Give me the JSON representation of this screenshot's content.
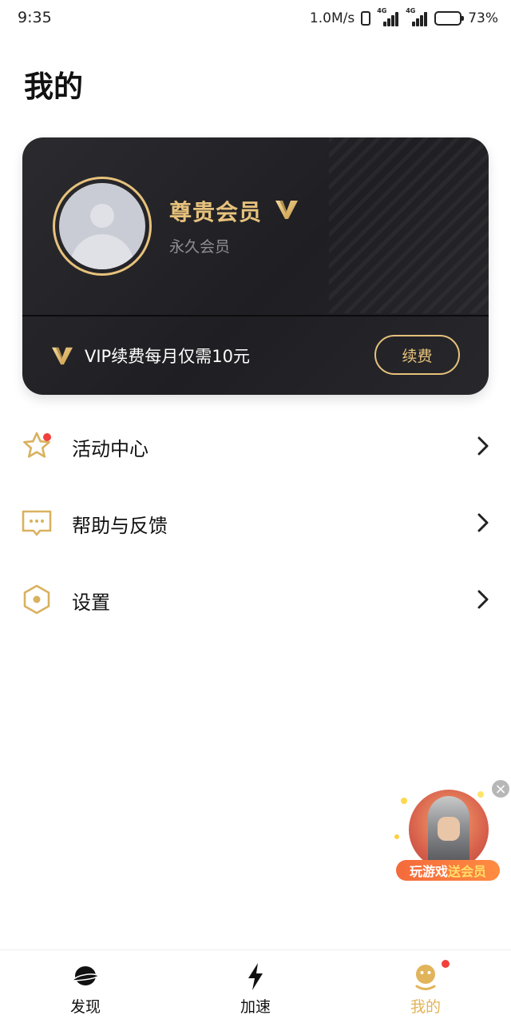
{
  "status_bar": {
    "time": "9:35",
    "net_speed": "1.0M/s",
    "sim1_tag": "4G",
    "sim2_tag": "4G",
    "battery": "73%"
  },
  "page_title": "我的",
  "vip_card": {
    "title": "尊贵会员",
    "subtitle": "永久会员",
    "renew_text": "VIP续费每月仅需10元",
    "renew_button": "续费",
    "accent_color": "#e7c27c"
  },
  "menu": {
    "items": [
      {
        "label": "活动中心",
        "icon": "star-icon",
        "has_badge": true
      },
      {
        "label": "帮助与反馈",
        "icon": "chat-bubble-icon",
        "has_badge": false
      },
      {
        "label": "设置",
        "icon": "hexagon-settings-icon",
        "has_badge": false
      }
    ]
  },
  "promo": {
    "text_part1": "玩游戏",
    "text_part2": "送会员",
    "close": "×"
  },
  "bottom_nav": {
    "items": [
      {
        "label": "发现",
        "icon": "planet-icon",
        "active": false
      },
      {
        "label": "加速",
        "icon": "lightning-icon",
        "active": false
      },
      {
        "label": "我的",
        "icon": "smiley-icon",
        "active": true,
        "has_badge": true
      }
    ],
    "active_color": "#e2b45a"
  }
}
